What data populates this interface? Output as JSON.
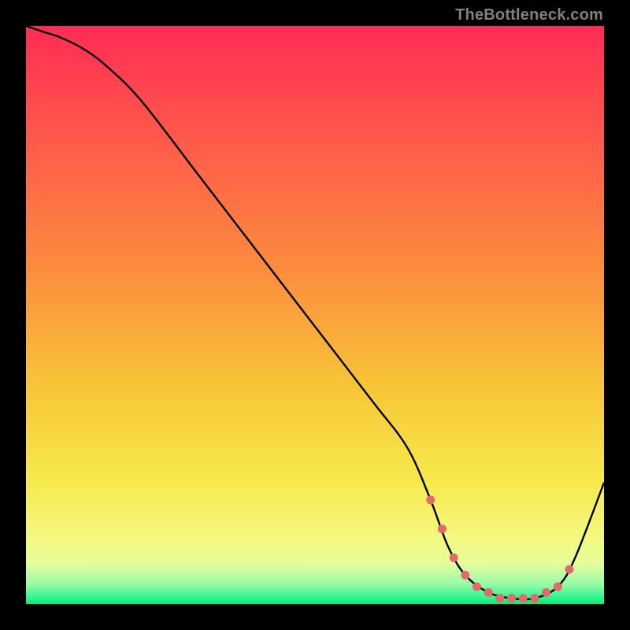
{
  "watermark": "TheBottleneck.com",
  "chart_data": {
    "type": "line",
    "title": "",
    "xlabel": "",
    "ylabel": "",
    "xlim": [
      0,
      100
    ],
    "ylim": [
      0,
      100
    ],
    "grid": false,
    "series": [
      {
        "name": "bottleneck-curve",
        "color": "#000000",
        "x": [
          0,
          3,
          6,
          10,
          14,
          20,
          30,
          40,
          50,
          60,
          66,
          70,
          73,
          76,
          80,
          84,
          88,
          92,
          95,
          100
        ],
        "y": [
          100,
          99,
          98,
          96,
          93,
          87,
          74,
          61,
          48,
          35,
          27,
          18,
          10,
          5,
          2,
          1,
          1,
          3,
          8,
          21
        ]
      }
    ],
    "markers": {
      "name": "highlighted-range",
      "color": "#E26A6A",
      "x": [
        70,
        72,
        74,
        76,
        78,
        80,
        82,
        84,
        86,
        88,
        90,
        92,
        94
      ],
      "y": [
        18,
        13,
        8,
        5,
        3,
        2,
        1,
        1,
        1,
        1,
        2,
        3,
        6
      ]
    },
    "gradient_stops": [
      {
        "offset": 0.0,
        "color": "#FF2C55"
      },
      {
        "offset": 0.2,
        "color": "#FF5A4A"
      },
      {
        "offset": 0.42,
        "color": "#FC8C3E"
      },
      {
        "offset": 0.62,
        "color": "#F8C437"
      },
      {
        "offset": 0.78,
        "color": "#F6E84A"
      },
      {
        "offset": 0.88,
        "color": "#F4F87C"
      },
      {
        "offset": 0.93,
        "color": "#E6FD9A"
      },
      {
        "offset": 0.965,
        "color": "#9BFBA7"
      },
      {
        "offset": 0.99,
        "color": "#2AF58E"
      },
      {
        "offset": 1.0,
        "color": "#0CE874"
      }
    ]
  }
}
